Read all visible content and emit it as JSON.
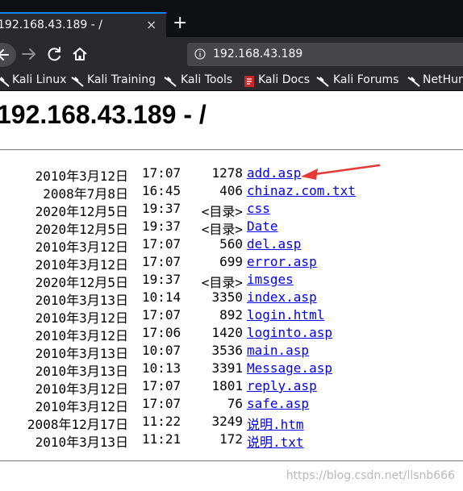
{
  "browser": {
    "tab_title": "192.168.43.189 - /",
    "tab_close": "×",
    "new_tab": "+",
    "url": "192.168.43.189",
    "bookmarks": [
      "Kali Linux",
      "Kali Training",
      "Kali Tools",
      "Kali Docs",
      "Kali Forums",
      "NetHun"
    ]
  },
  "page": {
    "title": "192.168.43.189 - /",
    "entries": [
      {
        "date": "2010年3月12日",
        "time": "17:07",
        "size": "1278",
        "name": "add.asp"
      },
      {
        "date": "2008年7月8日",
        "time": "16:45",
        "size": "406",
        "name": "chinaz.com.txt"
      },
      {
        "date": "2020年12月5日",
        "time": "19:37",
        "size": "<目录>",
        "name": "css"
      },
      {
        "date": "2020年12月5日",
        "time": "19:37",
        "size": "<目录>",
        "name": "Date"
      },
      {
        "date": "2010年3月12日",
        "time": "17:07",
        "size": "560",
        "name": "del.asp"
      },
      {
        "date": "2010年3月12日",
        "time": "17:07",
        "size": "699",
        "name": "error.asp"
      },
      {
        "date": "2020年12月5日",
        "time": "19:37",
        "size": "<目录>",
        "name": "imsges"
      },
      {
        "date": "2010年3月13日",
        "time": "10:14",
        "size": "3350",
        "name": "index.asp"
      },
      {
        "date": "2010年3月12日",
        "time": "17:07",
        "size": "892",
        "name": "login.html"
      },
      {
        "date": "2010年3月12日",
        "time": "17:06",
        "size": "1420",
        "name": "loginto.asp"
      },
      {
        "date": "2010年3月13日",
        "time": "10:07",
        "size": "3536",
        "name": "main.asp"
      },
      {
        "date": "2010年3月13日",
        "time": "10:13",
        "size": "3391",
        "name": "Message.asp"
      },
      {
        "date": "2010年3月12日",
        "time": "17:07",
        "size": "1801",
        "name": "reply.asp"
      },
      {
        "date": "2010年3月12日",
        "time": "17:07",
        "size": "76",
        "name": "safe.asp"
      },
      {
        "date": "2008年12月17日",
        "time": "11:22",
        "size": "3249",
        "name": "说明.htm"
      },
      {
        "date": "2010年3月13日",
        "time": "11:21",
        "size": "172",
        "name": "说明.txt"
      }
    ],
    "watermark": "https://blog.csdn.net/llsnb666"
  },
  "colors": {
    "link": "#0000ee",
    "arrow": "#e53935",
    "tab_accent": "#0a84ff"
  },
  "icons": [
    "back-arrow-icon",
    "forward-arrow-icon",
    "reload-icon",
    "home-icon",
    "info-icon",
    "kali-dragon-icon",
    "kali-docs-icon",
    "close-icon",
    "plus-icon"
  ]
}
